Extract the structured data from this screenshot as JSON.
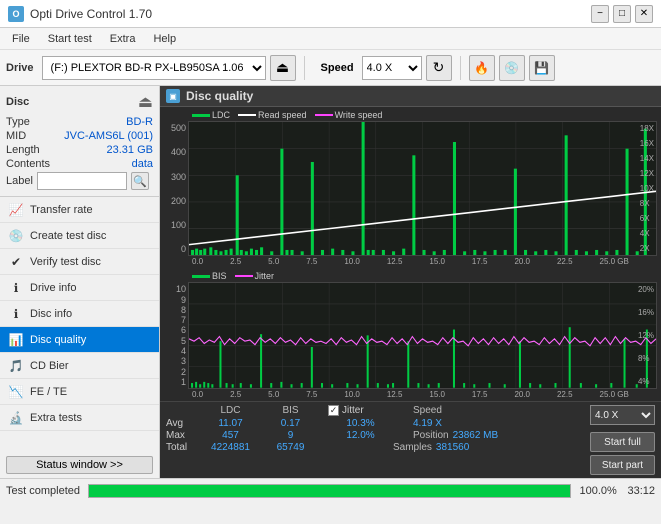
{
  "titleBar": {
    "title": "Opti Drive Control 1.70",
    "icon": "O",
    "minimizeLabel": "−",
    "maximizeLabel": "□",
    "closeLabel": "✕"
  },
  "menuBar": {
    "items": [
      "File",
      "Start test",
      "Extra",
      "Help"
    ]
  },
  "toolbar": {
    "driveLabel": "Drive",
    "driveValue": "(F:)  PLEXTOR BD-R   PX-LB950SA 1.06",
    "speedLabel": "Speed",
    "speedValue": "4.0 X"
  },
  "sidebar": {
    "discTitle": "Disc",
    "discFields": [
      {
        "key": "Type",
        "val": "BD-R"
      },
      {
        "key": "MID",
        "val": "JVC-AMS6L (001)"
      },
      {
        "key": "Length",
        "val": "23.31 GB"
      },
      {
        "key": "Contents",
        "val": "data"
      },
      {
        "key": "Label",
        "val": ""
      }
    ],
    "navItems": [
      {
        "id": "transfer-rate",
        "label": "Transfer rate",
        "icon": "📈"
      },
      {
        "id": "create-test-disc",
        "label": "Create test disc",
        "icon": "💿"
      },
      {
        "id": "verify-test-disc",
        "label": "Verify test disc",
        "icon": "✔"
      },
      {
        "id": "drive-info",
        "label": "Drive info",
        "icon": "ℹ"
      },
      {
        "id": "disc-info",
        "label": "Disc info",
        "icon": "ℹ"
      },
      {
        "id": "disc-quality",
        "label": "Disc quality",
        "icon": "📊",
        "active": true
      },
      {
        "id": "cd-bier",
        "label": "CD Bier",
        "icon": "🎵"
      },
      {
        "id": "fe-te",
        "label": "FE / TE",
        "icon": "📉"
      },
      {
        "id": "extra-tests",
        "label": "Extra tests",
        "icon": "🔬"
      }
    ],
    "statusWindowBtn": "Status window >>"
  },
  "panel": {
    "title": "Disc quality",
    "icon": "▣",
    "legend1": [
      "LDC",
      "Read speed",
      "Write speed"
    ],
    "legend2": [
      "BIS",
      "Jitter"
    ]
  },
  "stats": {
    "columns": [
      "LDC",
      "BIS",
      "",
      "Jitter",
      "Speed",
      ""
    ],
    "avg": {
      "ldc": "11.07",
      "bis": "0.17",
      "jitter": "10.3%",
      "speed": "4.19 X",
      "speedTarget": "4.0 X"
    },
    "max": {
      "ldc": "457",
      "bis": "9",
      "jitter": "12.0%",
      "position": "Position",
      "positionVal": "23862 MB"
    },
    "total": {
      "ldc": "4224881",
      "bis": "65749",
      "samples": "Samples",
      "samplesVal": "381560"
    },
    "startFull": "Start full",
    "startPart": "Start part"
  },
  "statusBar": {
    "text": "Test completed",
    "progress": 100,
    "percent": "100.0%",
    "time": "33:12"
  },
  "topChart": {
    "yLeft": [
      "500",
      "400",
      "300",
      "200",
      "100",
      "0"
    ],
    "yRight": [
      "18X",
      "16X",
      "14X",
      "12X",
      "10X",
      "8X",
      "6X",
      "4X",
      "2X"
    ],
    "xBottom": [
      "0.0",
      "2.5",
      "5.0",
      "7.5",
      "10.0",
      "12.5",
      "15.0",
      "17.5",
      "20.0",
      "22.5",
      "25.0 GB"
    ]
  },
  "bottomChart": {
    "yLeft": [
      "10",
      "9",
      "8",
      "7",
      "6",
      "5",
      "4",
      "3",
      "2",
      "1"
    ],
    "yRight": [
      "20%",
      "16%",
      "12%",
      "8%",
      "4%"
    ],
    "xBottom": [
      "0.0",
      "2.5",
      "5.0",
      "7.5",
      "10.0",
      "12.5",
      "15.0",
      "17.5",
      "20.0",
      "22.5",
      "25.0 GB"
    ]
  }
}
